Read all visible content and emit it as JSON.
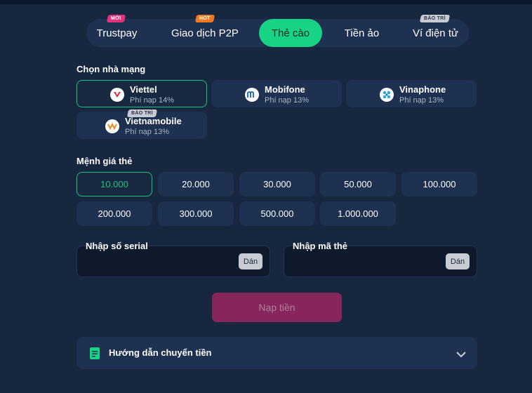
{
  "tabs": [
    {
      "label": "Trustpay",
      "badge": "MỚI"
    },
    {
      "label": "Giao dịch P2P",
      "badge": "HOT"
    },
    {
      "label": "Thẻ cào",
      "badge": ""
    },
    {
      "label": "Tiền ảo",
      "badge": ""
    },
    {
      "label": "Ví điện tử",
      "badge": "BẢO TRÌ"
    }
  ],
  "active_tab": "Thẻ cào",
  "carrier_section": {
    "label": "Chọn nhà mạng",
    "carriers": [
      {
        "name": "Viettel",
        "fee": "Phí nạp 14%",
        "icon": "viettel-logo-icon",
        "selected": true
      },
      {
        "name": "Mobifone",
        "fee": "Phí nạp 13%",
        "icon": "mobifone-logo-icon",
        "selected": false
      },
      {
        "name": "Vinaphone",
        "fee": "Phí nạp 13%",
        "icon": "vinaphone-logo-icon",
        "selected": false
      },
      {
        "name": "Vietnamobile",
        "fee": "Phí nạp 13%",
        "icon": "vietnamobile-logo-icon",
        "badge": "BẢO TRÌ",
        "selected": false
      }
    ]
  },
  "denomination_section": {
    "label": "Mệnh giá thẻ",
    "values": [
      "10.000",
      "20.000",
      "30.000",
      "50.000",
      "100.000",
      "200.000",
      "300.000",
      "500.000",
      "1.000.000"
    ],
    "selected": "10.000"
  },
  "inputs": {
    "serial": {
      "label": "Nhập số serial",
      "value": "",
      "paste_label": "Dán"
    },
    "code": {
      "label": "Nhập mã thẻ",
      "value": "",
      "paste_label": "Dán"
    }
  },
  "submit_label": "Nạp tiền",
  "guide": {
    "label": "Hướng dẫn chuyển tiền",
    "icon": "document-icon"
  },
  "colors": {
    "background": "#172740",
    "card": "#1e3150",
    "accent": "#17d484",
    "submit": "#86265c"
  }
}
